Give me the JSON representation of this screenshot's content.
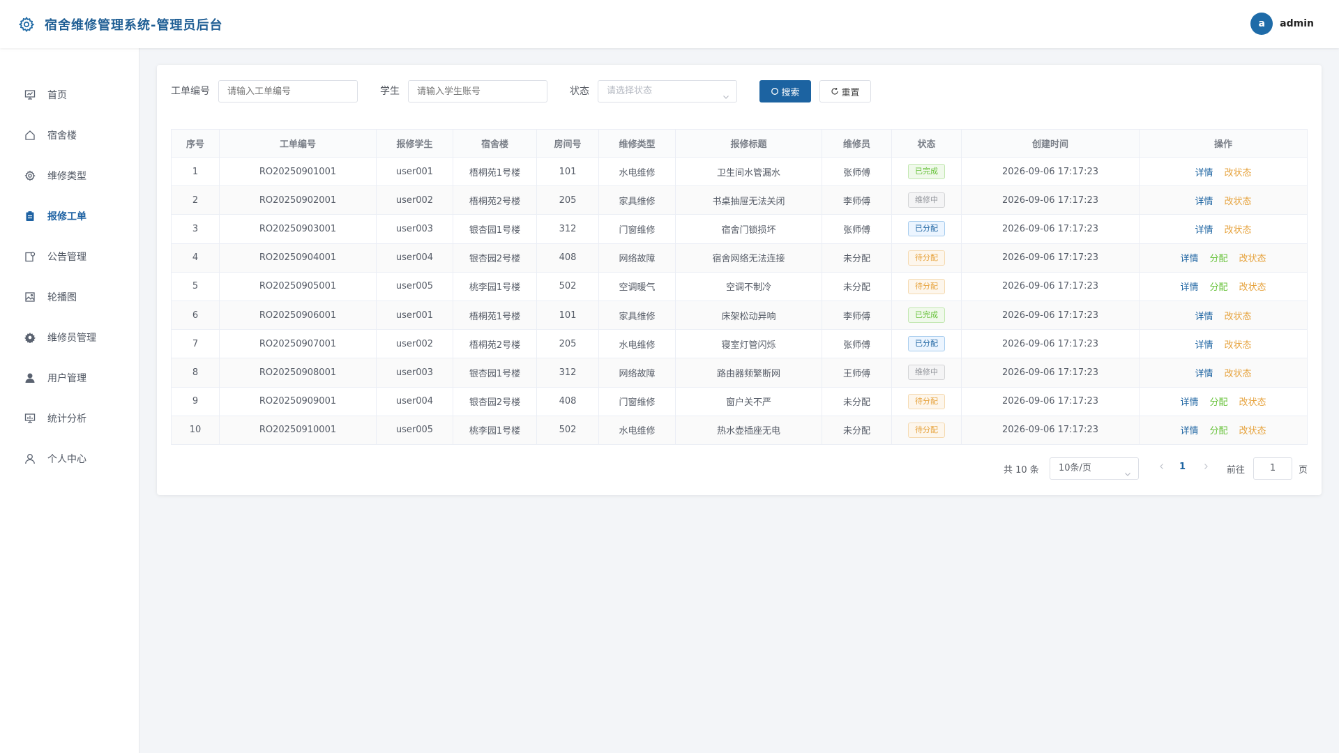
{
  "header": {
    "title": "宿舍维修管理系统-管理员后台",
    "avatar_letter": "a",
    "username": "admin"
  },
  "sidebar": {
    "items": [
      {
        "label": "首页",
        "icon": "presentation-icon"
      },
      {
        "label": "宿舍楼",
        "icon": "home-icon"
      },
      {
        "label": "维修类型",
        "icon": "gear-icon"
      },
      {
        "label": "报修工单",
        "icon": "clipboard-icon",
        "active": true
      },
      {
        "label": "公告管理",
        "icon": "notice-icon"
      },
      {
        "label": "轮播图",
        "icon": "image-icon"
      },
      {
        "label": "维修员管理",
        "icon": "cog-filled-icon"
      },
      {
        "label": "用户管理",
        "icon": "user-filled-icon"
      },
      {
        "label": "统计分析",
        "icon": "chart-icon"
      },
      {
        "label": "个人中心",
        "icon": "user-icon"
      }
    ]
  },
  "filters": {
    "order_no_label": "工单编号",
    "order_no_placeholder": "请输入工单编号",
    "student_label": "学生",
    "student_placeholder": "请输入学生账号",
    "status_label": "状态",
    "status_placeholder": "请选择状态",
    "search_label": "搜索",
    "reset_label": "重置"
  },
  "table": {
    "columns": [
      "序号",
      "工单编号",
      "报修学生",
      "宿舍楼",
      "房间号",
      "维修类型",
      "报修标题",
      "维修员",
      "状态",
      "创建时间",
      "操作"
    ],
    "rows": [
      {
        "no": "1",
        "order": "RO20250901001",
        "student": "user001",
        "building": "梧桐苑1号楼",
        "room": "101",
        "type": "水电维修",
        "title": "卫生间水管漏水",
        "worker": "张师傅",
        "status": "已完成",
        "status_kind": "done",
        "time": "2026-09-06 17:17:23"
      },
      {
        "no": "2",
        "order": "RO20250902001",
        "student": "user002",
        "building": "梧桐苑2号楼",
        "room": "205",
        "type": "家具维修",
        "title": "书桌抽屉无法关闭",
        "worker": "李师傅",
        "status": "维修中",
        "status_kind": "repairing",
        "time": "2026-09-06 17:17:23"
      },
      {
        "no": "3",
        "order": "RO20250903001",
        "student": "user003",
        "building": "银杏园1号楼",
        "room": "312",
        "type": "门窗维修",
        "title": "宿舍门锁损坏",
        "worker": "张师傅",
        "status": "已分配",
        "status_kind": "assigned",
        "time": "2026-09-06 17:17:23"
      },
      {
        "no": "4",
        "order": "RO20250904001",
        "student": "user004",
        "building": "银杏园2号楼",
        "room": "408",
        "type": "网络故障",
        "title": "宿舍网络无法连接",
        "worker": "未分配",
        "status": "待分配",
        "status_kind": "pending",
        "time": "2026-09-06 17:17:23"
      },
      {
        "no": "5",
        "order": "RO20250905001",
        "student": "user005",
        "building": "桃李园1号楼",
        "room": "502",
        "type": "空调暖气",
        "title": "空调不制冷",
        "worker": "未分配",
        "status": "待分配",
        "status_kind": "pending",
        "time": "2026-09-06 17:17:23"
      },
      {
        "no": "6",
        "order": "RO20250906001",
        "student": "user001",
        "building": "梧桐苑1号楼",
        "room": "101",
        "type": "家具维修",
        "title": "床架松动异响",
        "worker": "李师傅",
        "status": "已完成",
        "status_kind": "done",
        "time": "2026-09-06 17:17:23"
      },
      {
        "no": "7",
        "order": "RO20250907001",
        "student": "user002",
        "building": "梧桐苑2号楼",
        "room": "205",
        "type": "水电维修",
        "title": "寝室灯管闪烁",
        "worker": "张师傅",
        "status": "已分配",
        "status_kind": "assigned",
        "time": "2026-09-06 17:17:23"
      },
      {
        "no": "8",
        "order": "RO20250908001",
        "student": "user003",
        "building": "银杏园1号楼",
        "room": "312",
        "type": "网络故障",
        "title": "路由器频繁断网",
        "worker": "王师傅",
        "status": "维修中",
        "status_kind": "repairing",
        "time": "2026-09-06 17:17:23"
      },
      {
        "no": "9",
        "order": "RO20250909001",
        "student": "user004",
        "building": "银杏园2号楼",
        "room": "408",
        "type": "门窗维修",
        "title": "窗户关不严",
        "worker": "未分配",
        "status": "待分配",
        "status_kind": "pending",
        "time": "2026-09-06 17:17:23"
      },
      {
        "no": "10",
        "order": "RO20250910001",
        "student": "user005",
        "building": "桃李园1号楼",
        "room": "502",
        "type": "水电维修",
        "title": "热水壶插座无电",
        "worker": "未分配",
        "status": "待分配",
        "status_kind": "pending",
        "time": "2026-09-06 17:17:23"
      }
    ],
    "ops": {
      "detail": "详情",
      "assign": "分配",
      "change_status": "改状态"
    }
  },
  "status_colors": {
    "done": {
      "fg": "#67c23a",
      "bg": "#f0f9eb",
      "border": "#c2e7b0"
    },
    "repairing": {
      "fg": "#909399",
      "bg": "#f4f4f5",
      "border": "#d3d4d6"
    },
    "assigned": {
      "fg": "#1c63a1",
      "bg": "#ecf5ff",
      "border": "#a8cdee"
    },
    "pending": {
      "fg": "#e6a23c",
      "bg": "#fdf6ec",
      "border": "#f5dab1"
    }
  },
  "pagination": {
    "total": "共 10 条",
    "page_size": "10条/页",
    "current_page": "1",
    "goto_label": "前往",
    "goto_value": "1",
    "page_suffix": "页"
  }
}
